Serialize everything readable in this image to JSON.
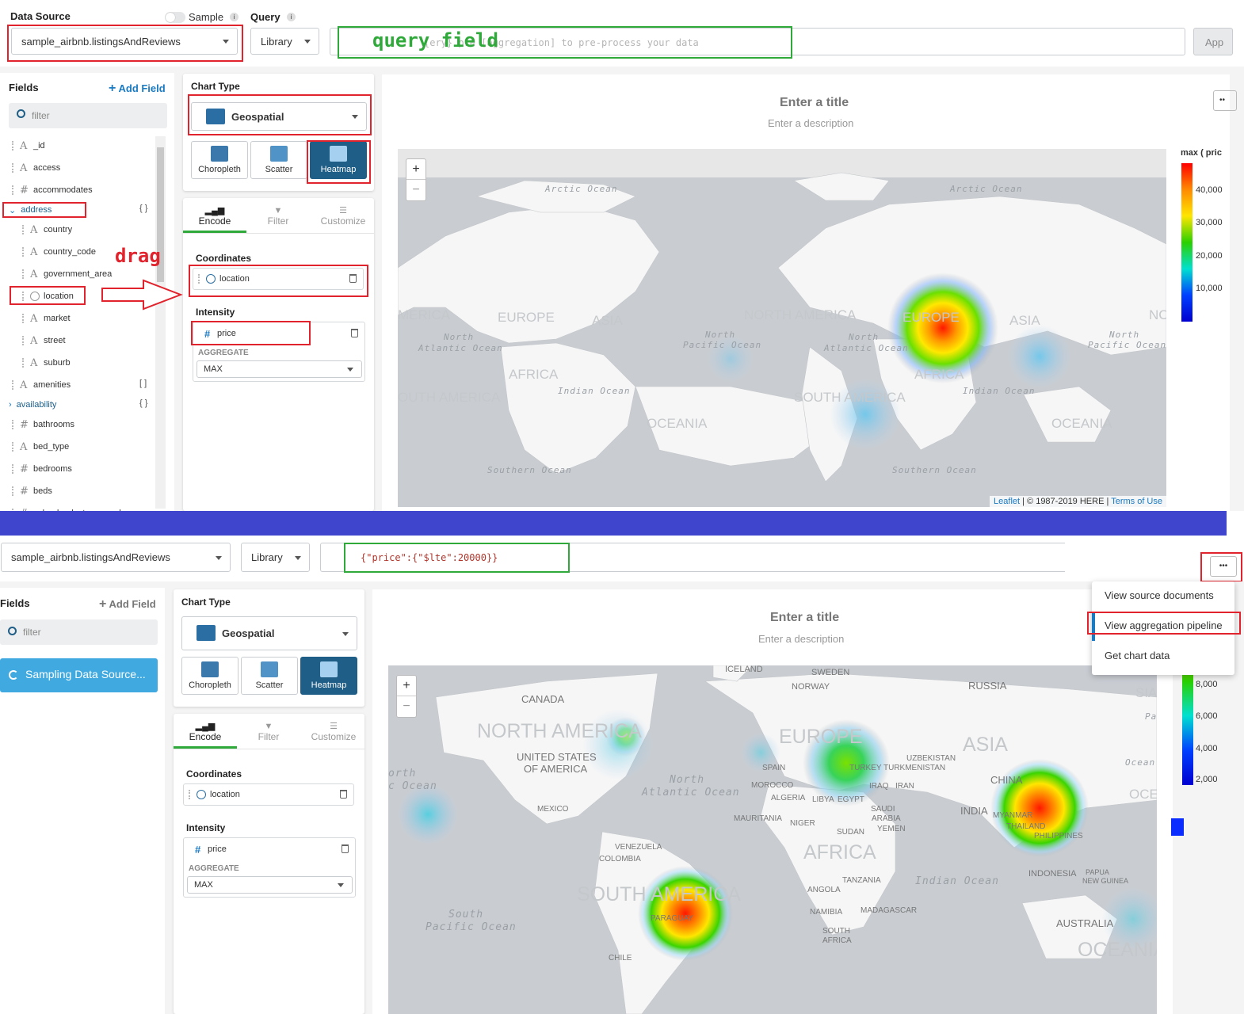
{
  "top": {
    "data_source_label": "Data Source",
    "sample_label": "Sample",
    "query_label": "Query",
    "data_source_value": "sample_airbnb.listingsAndReviews",
    "library_label": "Library",
    "query_placeholder": "{ery} pre [aggregation] to pre-process your data",
    "query_annotation": "query field",
    "apply_label": "App",
    "fields_title": "Fields",
    "add_field": "Add Field",
    "filter_placeholder": "filter",
    "fields": [
      {
        "type": "A",
        "name": "_id"
      },
      {
        "type": "A",
        "name": "access"
      },
      {
        "type": "#",
        "name": "accommodates"
      },
      {
        "type": "obj",
        "name": "address",
        "badge": "{ }"
      },
      {
        "type": "A",
        "name": "country"
      },
      {
        "type": "A",
        "name": "country_code"
      },
      {
        "type": "A",
        "name": "government_area"
      },
      {
        "type": "geo",
        "name": "location"
      },
      {
        "type": "A",
        "name": "market"
      },
      {
        "type": "A",
        "name": "street"
      },
      {
        "type": "A",
        "name": "suburb"
      },
      {
        "type": "A",
        "name": "amenities",
        "badge": "[ ]"
      },
      {
        "type": "obj",
        "name": "availability",
        "badge": "{ }"
      },
      {
        "type": "#",
        "name": "bathrooms"
      },
      {
        "type": "A",
        "name": "bed_type"
      },
      {
        "type": "#",
        "name": "bedrooms"
      },
      {
        "type": "#",
        "name": "beds"
      },
      {
        "type": "#",
        "name": "calendar_last_scraped"
      }
    ],
    "drag_annotation": "drag",
    "chart_type_label": "Chart Type",
    "chart_type_value": "Geospatial",
    "types": [
      "Choropleth",
      "Scatter",
      "Heatmap"
    ],
    "tabs": [
      "Encode",
      "Filter",
      "Customize"
    ],
    "coordinates_label": "Coordinates",
    "coordinates_field": "location",
    "intensity_label": "Intensity",
    "intensity_field": "price",
    "aggregate_label": "AGGREGATE",
    "aggregate_value": "MAX",
    "chart_title": "Enter a title",
    "chart_description": "Enter a description",
    "legend_title": "max ( pric",
    "legend_ticks": [
      "40,000",
      "30,000",
      "20,000",
      "10,000"
    ],
    "attribution_leaflet": "Leaflet",
    "attribution_text": "| © 1987-2019 HERE |",
    "attribution_terms": "Terms of Use",
    "map_labels": {
      "arctic1": "Arctic Ocean",
      "arctic2": "Arctic Ocean",
      "merica": "MERICA",
      "europe1": "EUROPE",
      "asia1": "ASIA",
      "na2": "NORTH AMERICA",
      "europe2": "EUROPE",
      "asia2": "ASIA",
      "nc": "NC",
      "nao1a": "North",
      "nao1b": "Atlantic Ocean",
      "npo1a": "North",
      "npo1b": "Pacific Ocean",
      "nao2a": "North",
      "nao2b": "Atlantic Ocean",
      "npo2a": "North",
      "npo2b": "Pacific Ocean",
      "africa1": "AFRICA",
      "africa2": "AFRICA",
      "io1": "Indian Ocean",
      "io2": "Indian Ocean",
      "sa1": "OUTH AMERICA",
      "sa2": "SOUTH AMERICA",
      "oceania1": "OCEANIA",
      "oceania2": "OCEANIA",
      "so1": "Southern Ocean",
      "so2": "Southern Ocean"
    }
  },
  "bottom": {
    "data_source_value": "sample_airbnb.listingsAndReviews",
    "library_label": "Library",
    "query_value": "{\"price\":{\"$lte\":20000}}",
    "fields_title": "Fields",
    "add_field": "Add Field",
    "filter_placeholder": "filter",
    "sampling_label": "Sampling Data Source...",
    "chart_type_label": "Chart Type",
    "chart_type_value": "Geospatial",
    "types": [
      "Choropleth",
      "Scatter",
      "Heatmap"
    ],
    "tabs": [
      "Encode",
      "Filter",
      "Customize"
    ],
    "coordinates_label": "Coordinates",
    "coordinates_field": "location",
    "intensity_label": "Intensity",
    "intensity_field": "price",
    "aggregate_label": "AGGREGATE",
    "aggregate_value": "MAX",
    "chart_title": "Enter a title",
    "chart_description": "Enter a description",
    "menu": [
      "View source documents",
      "View aggregation pipeline",
      "Get chart data"
    ],
    "more_label": "•••",
    "legend_ticks": [
      "8,000",
      "6,000",
      "4,000",
      "2,000"
    ],
    "map_labels": {
      "iceland": "ICELAND",
      "sweden": "SWEDEN",
      "norway": "NORWAY",
      "russia": "RUSSIA",
      "canada": "CANADA",
      "na": "NORTH AMERICA",
      "europe": "EUROPE",
      "asia": "ASIA",
      "sia": "SIA",
      "us1": "UNITED STATES",
      "us2": "OF AMERICA",
      "spain": "SPAIN",
      "turkey": "TURKEY",
      "uzbek": "UZBEKISTAN",
      "turkmen": "TURKMENISTAN",
      "orth": "orth",
      "cocean": "c Ocean",
      "nao_a": "North",
      "nao_b": "Atlantic Ocean",
      "morocco": "MOROCCO",
      "algeria": "ALGERIA",
      "libya": "LIBYA",
      "egypt": "EGYPT",
      "iraq": "IRAQ",
      "iran": "IRAN",
      "china": "CHINA",
      "ocean1": "Ocean",
      "oceani": "OCEANI",
      "pa": "Pa",
      "mexico": "MEXICO",
      "mauritania": "MAURITANIA",
      "niger": "NIGER",
      "sudan": "SUDAN",
      "saudi1": "SAUDI",
      "saudi2": "ARABIA",
      "yemen": "YEMEN",
      "india": "INDIA",
      "myanmar": "MYANMAR",
      "thailand": "THAILAND",
      "philippines": "PHILIPPINES",
      "venezuela": "VENEZUELA",
      "colombia": "COLOMBIA",
      "africa": "AFRICA",
      "tanzania": "TANZANIA",
      "angola": "ANGOLA",
      "io": "Indian Ocean",
      "indonesia": "INDONESIA",
      "png1": "PAPUA",
      "png2": "NEW GUINEA",
      "sa": "SOUTH AMERICA",
      "paraguay": "PARAGUAY",
      "namibia": "NAMIBIA",
      "madagascar": "MADAGASCAR",
      "spo_a": "South",
      "spo_b": "Pacific Ocean",
      "southafrica1": "SOUTH",
      "southafrica2": "AFRICA",
      "australia": "AUSTRALIA",
      "oceania": "OCEANIA",
      "chile": "CHILE"
    }
  },
  "colors": {
    "active_tile": "#1f5e86",
    "annotation_red": "#e0232d",
    "annotation_green": "#2fa93a",
    "separator": "#3f46cd",
    "sampling_button": "#3fa9e0",
    "link": "#1a7ac2"
  }
}
